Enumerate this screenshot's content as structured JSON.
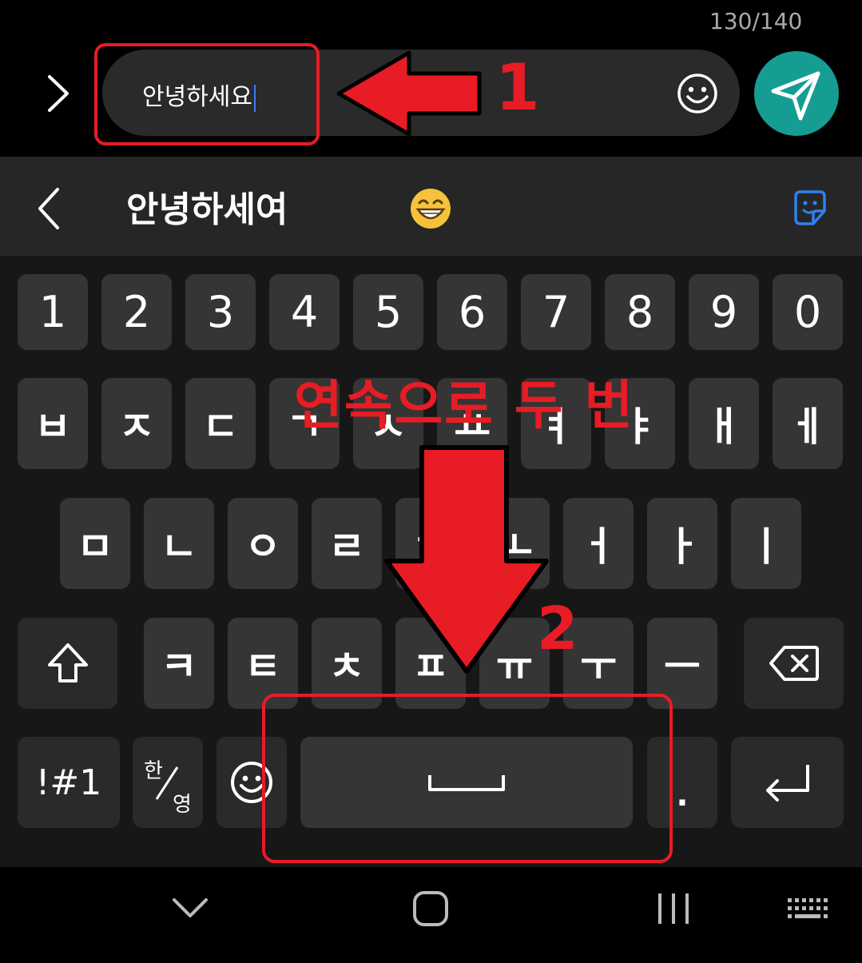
{
  "composer": {
    "char_counter": "130/140",
    "message_text": "안녕하세요",
    "expand_icon": "chevron-right-icon",
    "emoji_icon": "smiley-icon",
    "send_icon": "paper-plane-icon",
    "send_color": "#159d94"
  },
  "suggestion_bar": {
    "back_icon": "chevron-left-icon",
    "word": "안녕하세여",
    "emoji_icon": "grinning-face-emoji",
    "sticker_icon": "sticker-icon",
    "sticker_color": "#2f80ed"
  },
  "keyboard": {
    "number_row": [
      "1",
      "2",
      "3",
      "4",
      "5",
      "6",
      "7",
      "8",
      "9",
      "0"
    ],
    "row1": [
      "ㅂ",
      "ㅈ",
      "ㄷ",
      "ㄱ",
      "ㅅ",
      "ㅛ",
      "ㅕ",
      "ㅑ",
      "ㅐ",
      "ㅔ"
    ],
    "row2": [
      "ㅁ",
      "ㄴ",
      "ㅇ",
      "ㄹ",
      "ㅎ",
      "ㅗ",
      "ㅓ",
      "ㅏ",
      "ㅣ"
    ],
    "row3": [
      "ㅋ",
      "ㅌ",
      "ㅊ",
      "ㅍ",
      "ㅠ",
      "ㅜ",
      "ㅡ"
    ],
    "shift_icon": "shift-arrow-icon",
    "backspace_icon": "backspace-icon",
    "symbols_label": "!#1",
    "lang_top": "한",
    "lang_bottom": "영",
    "emoji_icon": "smiley-icon",
    "space_icon": "space-bar-icon",
    "period_label": ".",
    "enter_icon": "enter-return-icon"
  },
  "navigation_bar": {
    "hide_icon": "chevron-down-icon",
    "home_icon": "home-rounded-square-icon",
    "recents_icon": "recents-bars-icon",
    "keyboard_icon": "keyboard-icon"
  },
  "annotations": {
    "color": "#e81c24",
    "step1_label": "1",
    "step2_label": "2",
    "instruction": "연속으로 두 번"
  }
}
